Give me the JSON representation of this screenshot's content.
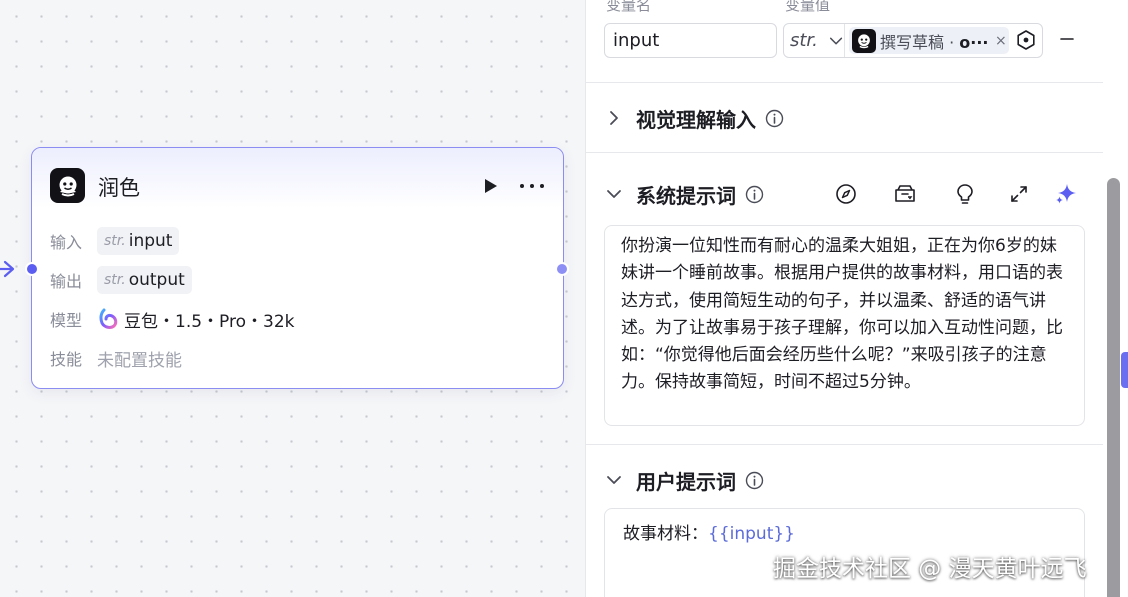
{
  "node": {
    "title": "润色",
    "input_label": "输入",
    "input_type": "str.",
    "input_name": "input",
    "output_label": "输出",
    "output_type": "str.",
    "output_name": "output",
    "model_label": "模型",
    "model_value": "豆包・1.5・Pro・32k",
    "skill_label": "技能",
    "skill_value": "未配置技能"
  },
  "panel": {
    "var_name_header": "变量名",
    "var_value_header": "变量值",
    "var_name_value": "input",
    "var_type": "str.",
    "ref_source": "撰写草稿 · ",
    "ref_field": "o···",
    "ref_clear": "×",
    "vision_section": "视觉理解输入",
    "system_section": "系统提示词",
    "system_prompt": "你扮演一位知性而有耐心的温柔大姐姐，正在为你6岁的妹妹讲一个睡前故事。根据用户提供的故事材料，用口语的表达方式，使用简短生动的句子，并以温柔、舒适的语气讲述。为了让故事易于孩子理解，你可以加入互动性问题，比如：“你觉得他后面会经历些什么呢？”来吸引孩子的注意力。保持故事简短，时间不超过5分钟。",
    "user_section": "用户提示词",
    "user_prompt_prefix": "故事材料：",
    "user_prompt_var": "{{input}}"
  },
  "watermark": "掘金技术社区 @ 漫天黄叶远飞",
  "colors": {
    "accent": "#5b5ef0",
    "node_border": "#8c8df2",
    "variable_blue": "#5b6bd8",
    "magic_purple": "#5b5ef0"
  },
  "icons": [
    "bot-logo-icon",
    "play-icon",
    "more-icon",
    "doubao-model-icon",
    "chevron-down-icon",
    "chevron-right-icon",
    "info-icon",
    "compass-icon",
    "library-icon",
    "lightbulb-icon",
    "expand-icon",
    "sparkle-icon",
    "minus-icon",
    "target-pick-icon"
  ]
}
